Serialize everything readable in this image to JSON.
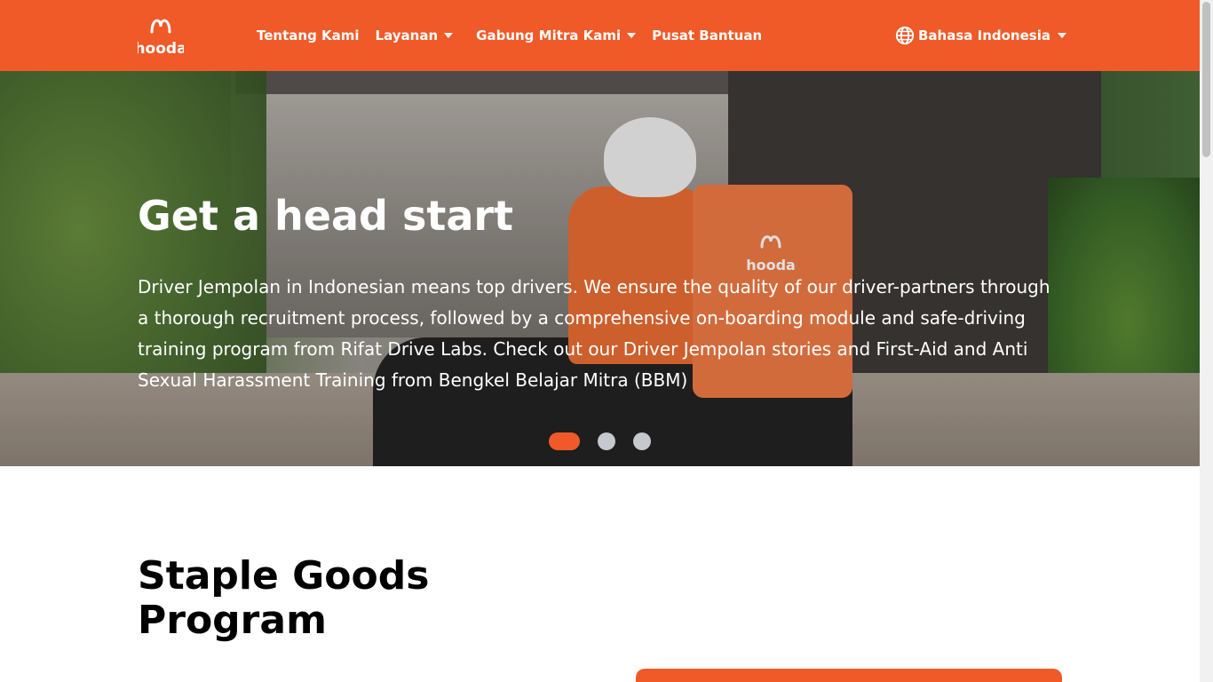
{
  "header": {
    "logo_text": "hooda",
    "nav": [
      {
        "label": "Tentang Kami",
        "has_dropdown": false
      },
      {
        "label": "Layanan",
        "has_dropdown": true
      },
      {
        "label": "Gabung Mitra Kami",
        "has_dropdown": true
      },
      {
        "label": "Pusat Bantuan",
        "has_dropdown": false
      }
    ],
    "language": {
      "label": "Bahasa Indonesia",
      "icon": "globe-icon"
    }
  },
  "hero": {
    "title": "Get a head start",
    "description": "Driver Jempolan in Indonesian means top drivers. We ensure the quality of our driver-partners through a thorough recruitment process, followed by a comprehensive on-boarding module and safe-driving training program from Rifat Drive Labs. Check out our Driver Jempolan stories and First-Aid and Anti Sexual Harassment Training from Bengkel Belajar Mitra (BBM)",
    "slides_count": 3,
    "active_slide": 1,
    "bag_logo": "hooda"
  },
  "section": {
    "title": "Staple Goods Program"
  },
  "colors": {
    "brand": "#f05a28",
    "dot_inactive": "#c6c8cf",
    "white": "#ffffff"
  }
}
